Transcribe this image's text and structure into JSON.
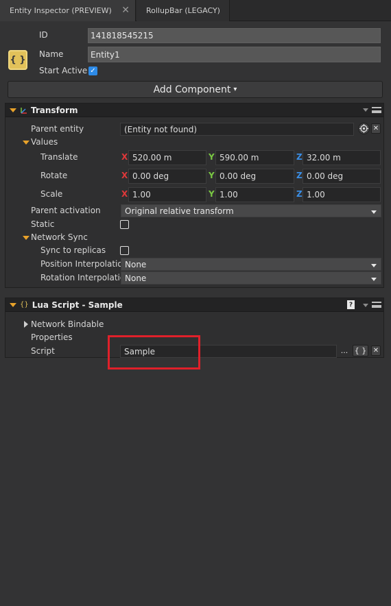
{
  "tabs": [
    {
      "label": "Entity Inspector (PREVIEW)",
      "close": "✕"
    },
    {
      "label": "RollupBar (LEGACY)"
    }
  ],
  "entity": {
    "id_label": "ID",
    "id_value": "141818545215",
    "name_label": "Name",
    "name_value": "Entity1",
    "start_active_label": "Start Active",
    "start_active_checked": true,
    "icon_glyph": "{ }"
  },
  "add_component": {
    "label": "Add Component",
    "caret": "▾"
  },
  "transform": {
    "title": "Transform",
    "parent_entity_label": "Parent entity",
    "parent_entity_value": "(Entity not found)",
    "values_label": "Values",
    "translate_label": "Translate",
    "translate": {
      "x": "520.00 m",
      "y": "590.00 m",
      "z": "32.00 m"
    },
    "rotate_label": "Rotate",
    "rotate": {
      "x": "0.00 deg",
      "y": "0.00 deg",
      "z": "0.00 deg"
    },
    "scale_label": "Scale",
    "scale": {
      "x": "1.00",
      "y": "1.00",
      "z": "1.00"
    },
    "parent_activation_label": "Parent activation",
    "parent_activation_value": "Original relative transform",
    "static_label": "Static",
    "network_sync_label": "Network Sync",
    "sync_replicas_label": "Sync to replicas",
    "position_interp_label": "Position Interpolation",
    "position_interp_value": "None",
    "rotation_interp_label": "Rotation Interpolation",
    "rotation_interp_value": "None"
  },
  "axes": {
    "x": "X",
    "y": "Y",
    "z": "Z"
  },
  "axis_colors": {
    "x": "#e0383a",
    "y": "#7ac943",
    "z": "#3a8ee6"
  },
  "lua": {
    "title": "Lua Script - Sample",
    "title_icon": "{}",
    "help": "?",
    "network_bindable_label": "Network Bindable",
    "properties_label": "Properties",
    "script_label": "Script",
    "script_value": "Sample",
    "browse_label": "...",
    "edit_label": "{ }",
    "clear_label": "✕"
  },
  "colors": {
    "accent_orange": "#e8a22a",
    "highlight_red": "#e0202a",
    "checkbox_blue": "#2d8be8"
  }
}
